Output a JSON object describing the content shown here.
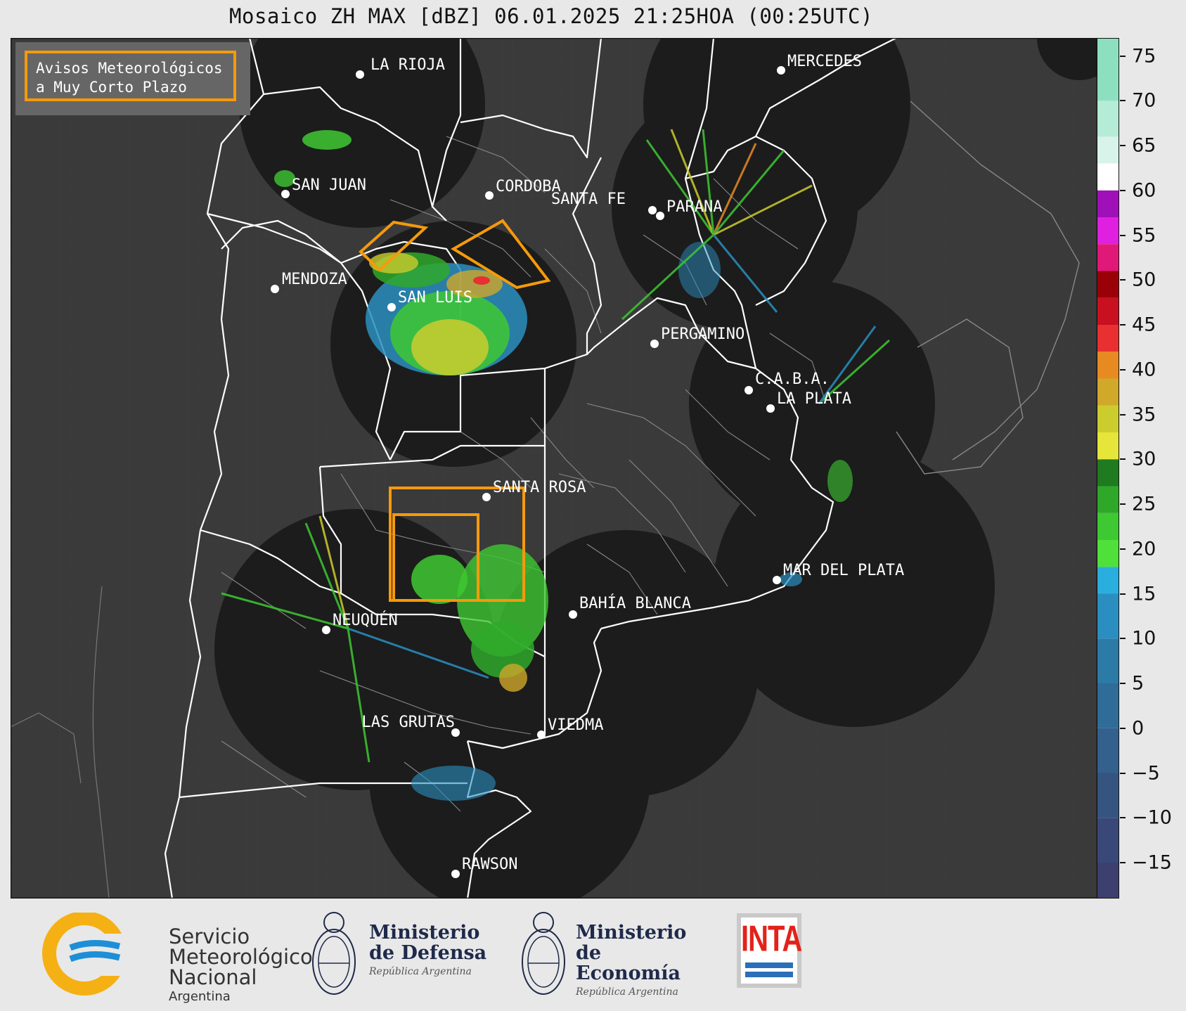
{
  "title": "Mosaico ZH MAX [dBZ] 06.01.2025 21:25HOA (00:25UTC)",
  "legend": {
    "line1": "Avisos Meteorológicos",
    "line2": "a Muy Corto Plazo",
    "border_color": "#f59a0b"
  },
  "cities": [
    {
      "name": "LA RIOJA"
    },
    {
      "name": "SAN JUAN"
    },
    {
      "name": "CORDOBA"
    },
    {
      "name": "SANTA FE"
    },
    {
      "name": "PARANA"
    },
    {
      "name": "MERCEDES"
    },
    {
      "name": "MENDOZA"
    },
    {
      "name": "SAN LUIS"
    },
    {
      "name": "PERGAMINO"
    },
    {
      "name": "C.A.B.A."
    },
    {
      "name": "LA PLATA"
    },
    {
      "name": "SANTA ROSA"
    },
    {
      "name": "NEUQUÉN"
    },
    {
      "name": "BAHÍA BLANCA"
    },
    {
      "name": "MAR DEL PLATA"
    },
    {
      "name": "LAS GRUTAS"
    },
    {
      "name": "VIEDMA"
    },
    {
      "name": "RAWSON"
    }
  ],
  "colorbar": {
    "unit": "dBZ",
    "min": -19,
    "max": 77,
    "ticks": [
      "75",
      "70",
      "65",
      "60",
      "55",
      "50",
      "45",
      "40",
      "35",
      "30",
      "25",
      "20",
      "15",
      "10",
      "5",
      "0",
      "−5",
      "−10",
      "−15"
    ],
    "tick_values": [
      75,
      70,
      65,
      60,
      55,
      50,
      45,
      40,
      35,
      30,
      25,
      20,
      15,
      10,
      5,
      0,
      -5,
      -10,
      -15
    ],
    "bands": [
      {
        "from": -19,
        "to": -15,
        "color": "#3d3f6e"
      },
      {
        "from": -15,
        "to": -10,
        "color": "#3a4878"
      },
      {
        "from": -10,
        "to": -5,
        "color": "#365480"
      },
      {
        "from": -5,
        "to": 0,
        "color": "#33608c"
      },
      {
        "from": 0,
        "to": 5,
        "color": "#2f6c98"
      },
      {
        "from": 5,
        "to": 10,
        "color": "#2c7aa6"
      },
      {
        "from": 10,
        "to": 15,
        "color": "#2a8fc0"
      },
      {
        "from": 15,
        "to": 18,
        "color": "#2aaede"
      },
      {
        "from": 18,
        "to": 21,
        "color": "#4fe03a"
      },
      {
        "from": 21,
        "to": 24,
        "color": "#3ec832"
      },
      {
        "from": 24,
        "to": 27,
        "color": "#2fa82a"
      },
      {
        "from": 27,
        "to": 30,
        "color": "#1f7a20"
      },
      {
        "from": 30,
        "to": 33,
        "color": "#e6e63a"
      },
      {
        "from": 33,
        "to": 36,
        "color": "#cccc2e"
      },
      {
        "from": 36,
        "to": 39,
        "color": "#d0a82a"
      },
      {
        "from": 39,
        "to": 42,
        "color": "#e88a22"
      },
      {
        "from": 42,
        "to": 45,
        "color": "#e83030"
      },
      {
        "from": 45,
        "to": 48,
        "color": "#c81020"
      },
      {
        "from": 48,
        "to": 51,
        "color": "#9a0008"
      },
      {
        "from": 51,
        "to": 54,
        "color": "#e01878"
      },
      {
        "from": 54,
        "to": 57,
        "color": "#e020e0"
      },
      {
        "from": 57,
        "to": 60,
        "color": "#a010b8"
      },
      {
        "from": 60,
        "to": 63,
        "color": "#ffffff"
      },
      {
        "from": 63,
        "to": 66,
        "color": "#d8f4ea"
      },
      {
        "from": 66,
        "to": 70,
        "color": "#b4ecd8"
      },
      {
        "from": 70,
        "to": 77,
        "color": "#8ce0c0"
      }
    ]
  },
  "logos": {
    "smn": {
      "line1": "Servicio",
      "line2": "Meteorológico",
      "line3": "Nacional",
      "sub": "Argentina"
    },
    "defensa": {
      "line1": "Ministerio",
      "line2": "de Defensa",
      "sub": "República Argentina"
    },
    "economia": {
      "line1": "Ministerio",
      "line2": "de Economía",
      "sub": "República Argentina"
    },
    "inta": {
      "word": "INTA"
    }
  },
  "colors": {
    "map_background": "#3a3a3a",
    "radar_coverage": "#1c1c1c",
    "province_border": "#ffffff",
    "warning_polygon": "#f59a0b"
  }
}
